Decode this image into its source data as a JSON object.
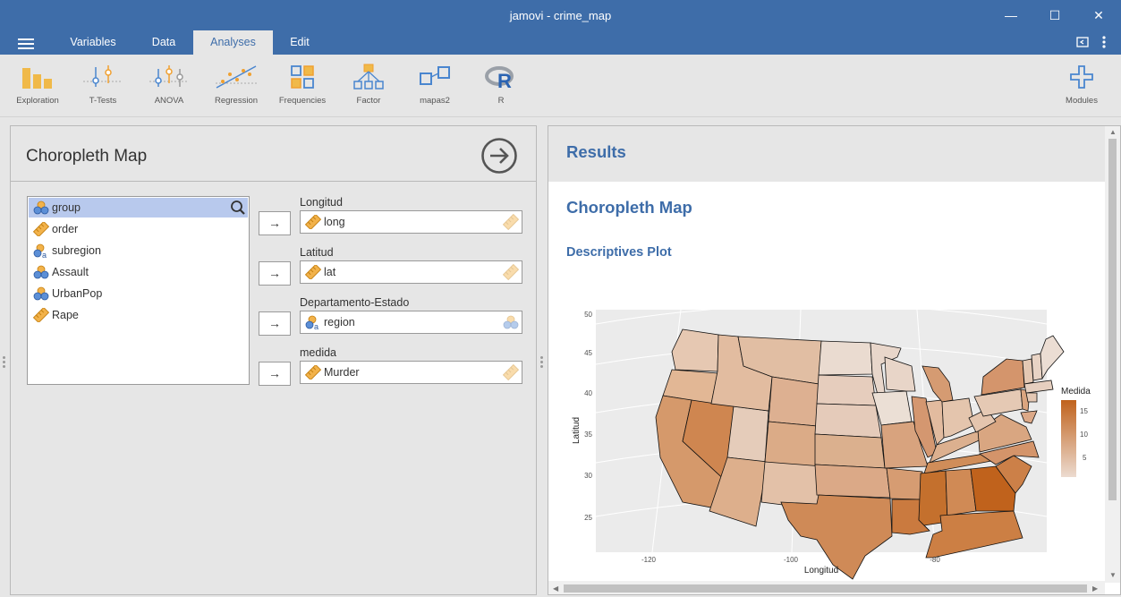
{
  "window": {
    "title": "jamovi - crime_map"
  },
  "tabs": [
    "Variables",
    "Data",
    "Analyses",
    "Edit"
  ],
  "active_tab": "Analyses",
  "ribbon": {
    "items": [
      "Exploration",
      "T-Tests",
      "ANOVA",
      "Regression",
      "Frequencies",
      "Factor",
      "mapas2",
      "R"
    ],
    "modules_label": "Modules"
  },
  "analysis": {
    "title": "Choropleth Map",
    "variables": [
      {
        "name": "group",
        "type": "nominal"
      },
      {
        "name": "order",
        "type": "continuous"
      },
      {
        "name": "subregion",
        "type": "nominal-text"
      },
      {
        "name": "Assault",
        "type": "nominal"
      },
      {
        "name": "UrbanPop",
        "type": "nominal"
      },
      {
        "name": "Rape",
        "type": "continuous"
      }
    ],
    "selected_variable": "group",
    "fields": [
      {
        "label": "Longitud",
        "value": "long",
        "type": "continuous"
      },
      {
        "label": "Latitud",
        "value": "lat",
        "type": "continuous"
      },
      {
        "label": "Departamento-Estado",
        "value": "region",
        "type": "nominal-text"
      },
      {
        "label": "medida",
        "value": "Murder",
        "type": "continuous"
      }
    ]
  },
  "results": {
    "header": "Results",
    "analysis_title": "Choropleth Map",
    "plot_title": "Descriptives Plot"
  },
  "plot": {
    "xlabel": "Longitud",
    "ylabel": "Latitud",
    "x_ticks": [
      "-120",
      "-100",
      "-80"
    ],
    "y_ticks": [
      "50",
      "45",
      "40",
      "35",
      "30",
      "25"
    ],
    "legend_title": "Medida",
    "legend_ticks": [
      "15",
      "10",
      "5"
    ],
    "colors": {
      "low": "#ecdbd0",
      "high": "#c0621c",
      "panel": "#ebebeb",
      "accent": "#3e6da9"
    }
  }
}
